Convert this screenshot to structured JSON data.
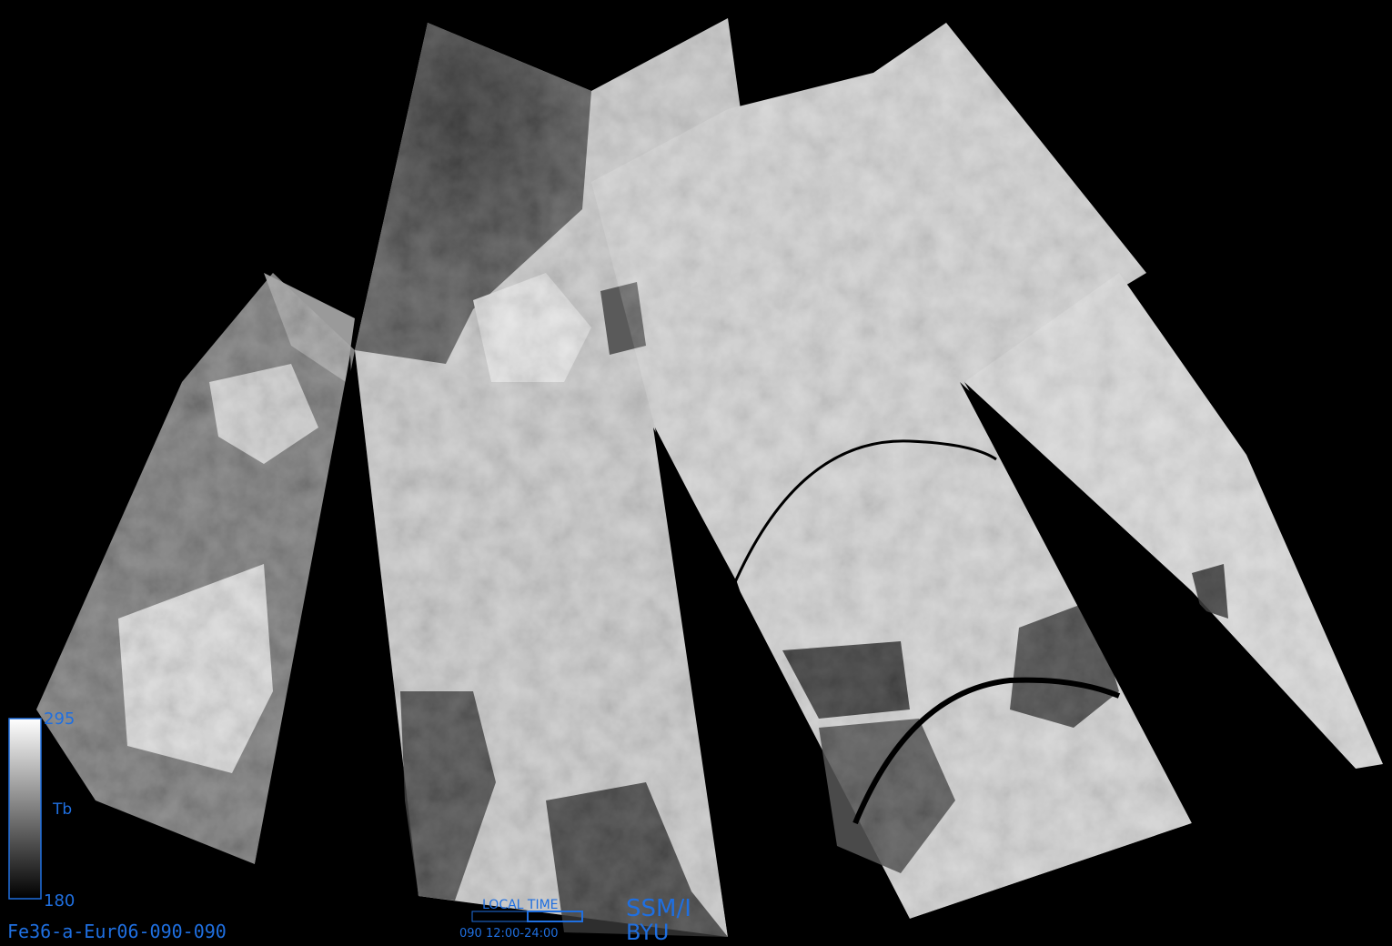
{
  "image": {
    "subject": "SSM/I brightness temperature swath composite over Europe",
    "colors": {
      "background": "#000000",
      "annotation": "#1f6fe0",
      "swath_light": "#d6d6d6",
      "swath_mid": "#8a8a8a",
      "swath_dark": "#2a2a2a"
    }
  },
  "colorbar": {
    "max_label": "295",
    "min_label": "180",
    "quantity_label": "Tb"
  },
  "footer": {
    "filename": "Fe36-a-Eur06-090-090",
    "local_time_label": "LOCAL TIME",
    "local_time_range": "090 12:00-24:00",
    "sensor": "SSM/I",
    "institution": "BYU"
  }
}
